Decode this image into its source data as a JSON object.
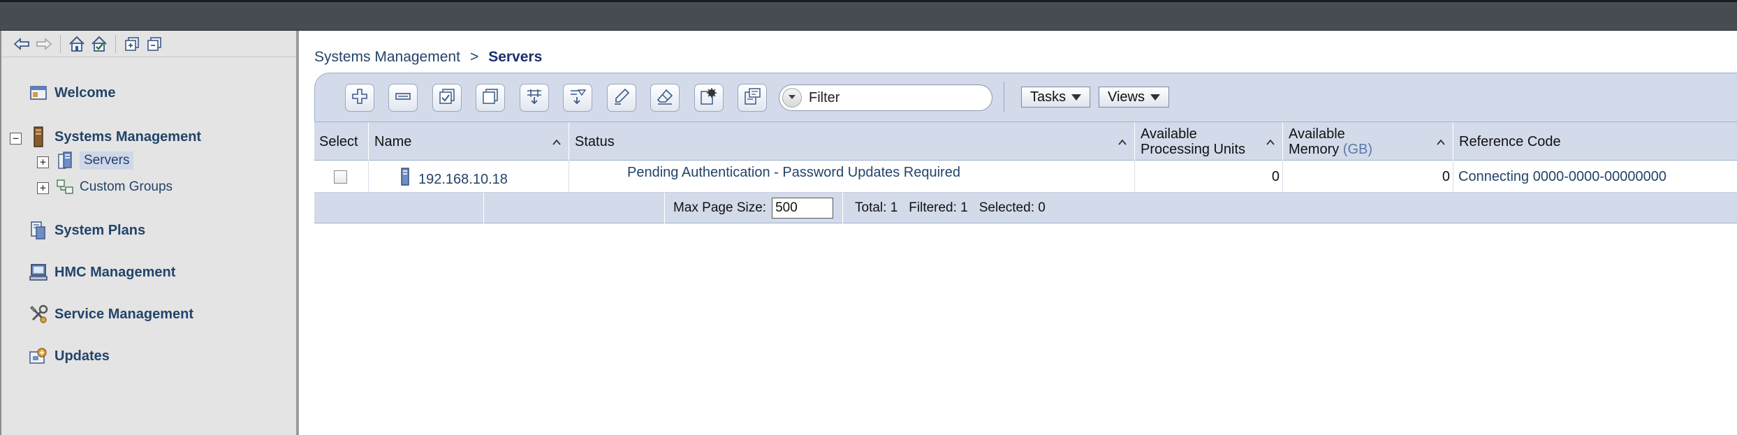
{
  "nav": {
    "toolbar_icons": [
      "back-arrow-icon",
      "forward-arrow-icon",
      "home-icon",
      "checklist-icon",
      "expand-all-icon",
      "collapse-all-icon"
    ],
    "items": [
      {
        "label": "Welcome",
        "icon": "welcome-window-icon"
      },
      {
        "label": "Systems Management",
        "icon": "server-tower-icon",
        "expanded": true,
        "children": [
          {
            "label": "Servers",
            "icon": "servers-icon",
            "selected": true
          },
          {
            "label": "Custom Groups",
            "icon": "custom-groups-icon"
          }
        ]
      },
      {
        "label": "System Plans",
        "icon": "system-plans-icon"
      },
      {
        "label": "HMC Management",
        "icon": "monitor-icon"
      },
      {
        "label": "Service Management",
        "icon": "tools-icon"
      },
      {
        "label": "Updates",
        "icon": "updates-icon"
      }
    ]
  },
  "breadcrumb": {
    "parent": "Systems Management",
    "separator": ">",
    "current": "Servers"
  },
  "toolbar": {
    "buttons": [
      "add-icon",
      "remove-icon",
      "select-all-icon",
      "deselect-all-icon",
      "configure-columns-icon",
      "filter-rows-icon",
      "edit-sort-icon",
      "clear-sort-icon",
      "settings-icon",
      "properties-icon"
    ],
    "filter_placeholder": "Filter",
    "tasks_label": "Tasks",
    "views_label": "Views"
  },
  "table": {
    "columns": {
      "select": "Select",
      "name": "Name",
      "status": "Status",
      "processing_line1": "Available",
      "processing_line2": "Processing Units",
      "memory_line1": "Available",
      "memory_line2": "Memory",
      "memory_unit": "(GB)",
      "reference": "Reference Code"
    },
    "rows": [
      {
        "selected": false,
        "name": "192.168.10.18",
        "status": "Pending Authentication - Password Updates Required",
        "processing_units": "0",
        "memory": "0",
        "reference_code": "Connecting 0000-0000-00000000"
      }
    ],
    "footer": {
      "max_page_size_label": "Max Page Size:",
      "max_page_size_value": "500",
      "total": "Total: 1",
      "filtered": "Filtered: 1",
      "selected": "Selected: 0"
    }
  },
  "colors": {
    "link": "#23446a",
    "header_bg": "#d3dbea",
    "nav_bg": "#e4e4e4",
    "topbar_bg": "#474b52"
  }
}
